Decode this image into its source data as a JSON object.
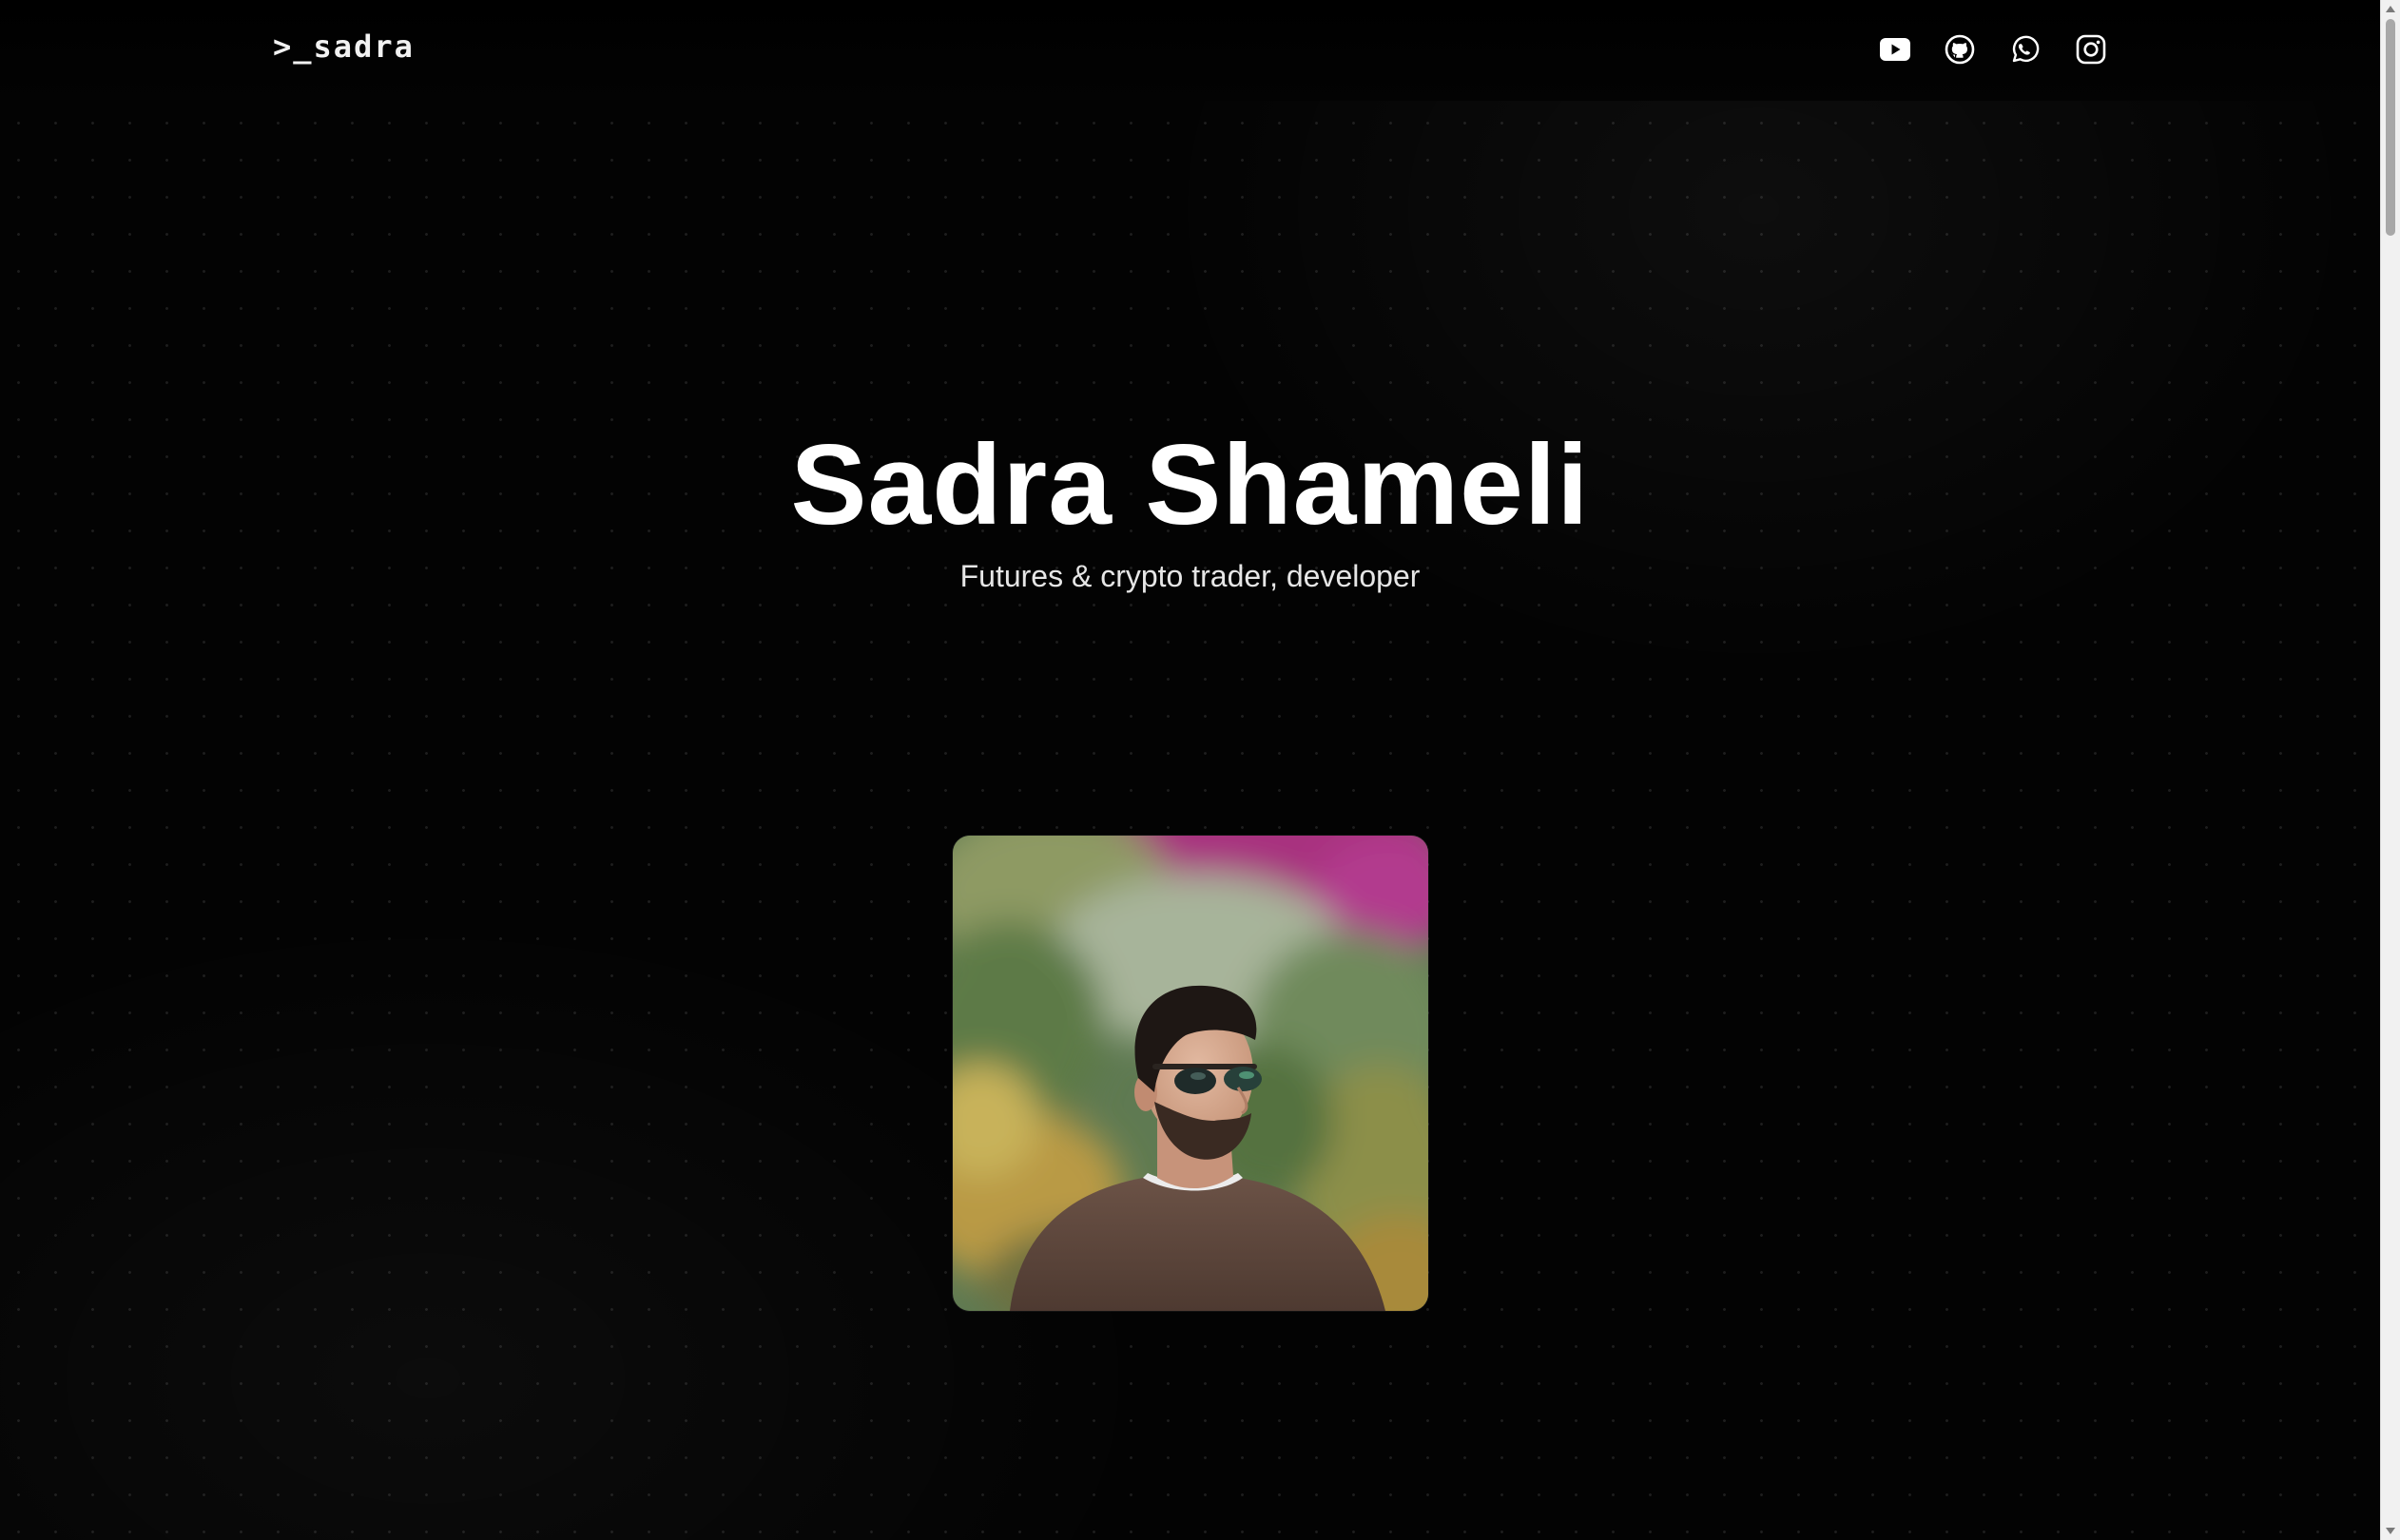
{
  "header": {
    "logo": ">_sadra",
    "social": [
      {
        "name": "youtube-icon"
      },
      {
        "name": "github-icon"
      },
      {
        "name": "whatsapp-icon"
      },
      {
        "name": "instagram-icon"
      }
    ]
  },
  "hero": {
    "title": "Sadra Shameli",
    "subtitle": "Futures & crypto trader, developer"
  },
  "portrait": {
    "alt": "Portrait photo"
  },
  "colors": {
    "background": "#030303",
    "text": "#ffffff",
    "subtitle": "#e6e6e6"
  }
}
